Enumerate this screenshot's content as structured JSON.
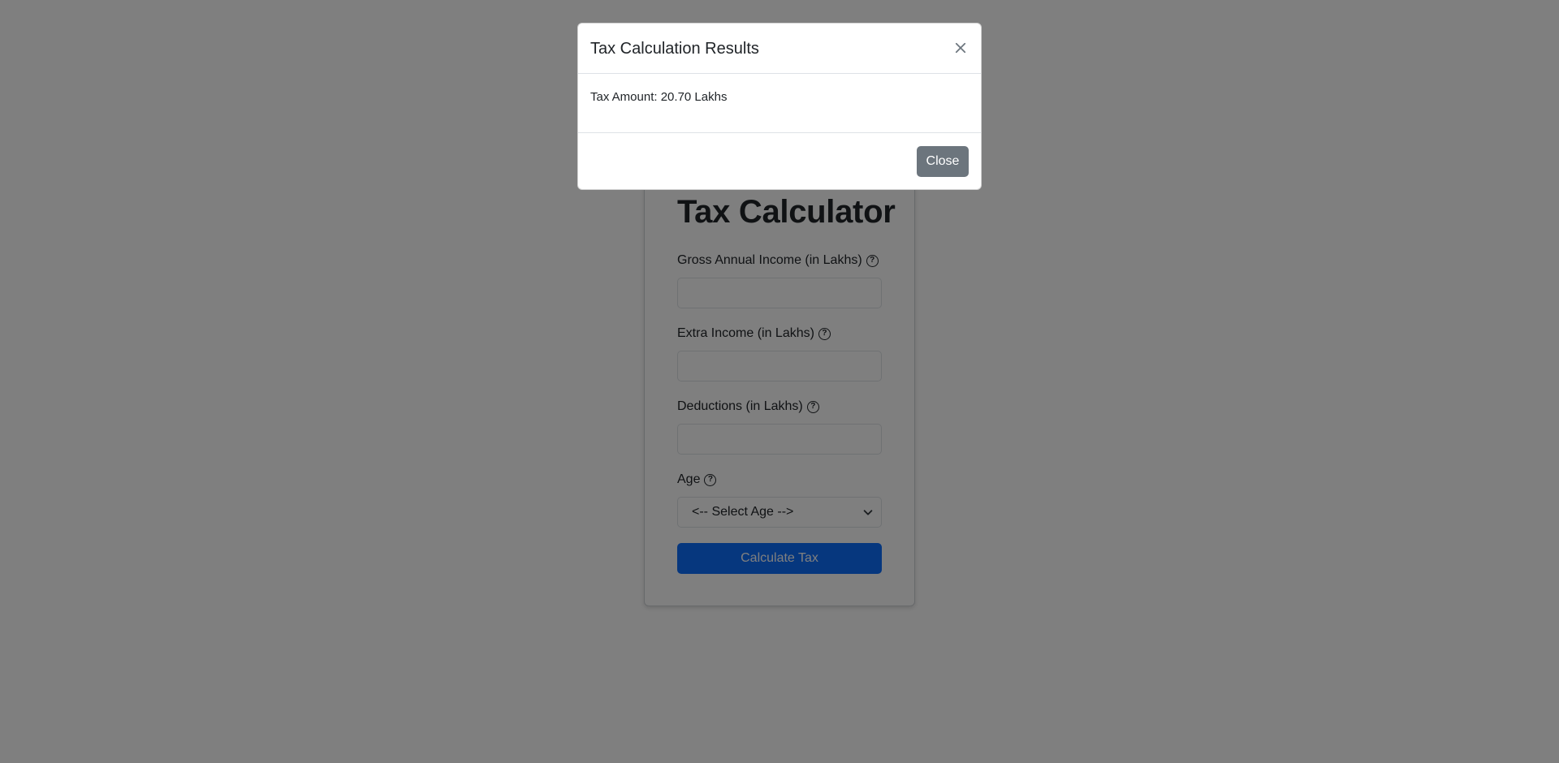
{
  "calculator": {
    "title": "Tax Calculator",
    "fields": [
      {
        "label": "Gross Annual Income (in Lakhs)",
        "value": "",
        "placeholder": "",
        "help_icon": "question-circle-icon"
      },
      {
        "label": "Extra Income (in Lakhs)",
        "value": "",
        "placeholder": "",
        "help_icon": "question-circle-icon"
      },
      {
        "label": "Deductions (in Lakhs)",
        "value": "",
        "placeholder": "",
        "help_icon": "question-circle-icon"
      }
    ],
    "age": {
      "label": "Age",
      "help_icon": "question-circle-icon",
      "selected": "<-- Select Age -->"
    },
    "submit_label": "Calculate Tax",
    "colors": {
      "primary": "#0d6efd"
    }
  },
  "modal": {
    "title": "Tax Calculation Results",
    "close_icon": "close-icon",
    "result_text": "Tax Amount: 20.70 Lakhs",
    "close_label": "Close",
    "colors": {
      "secondary": "#6c757d"
    }
  }
}
